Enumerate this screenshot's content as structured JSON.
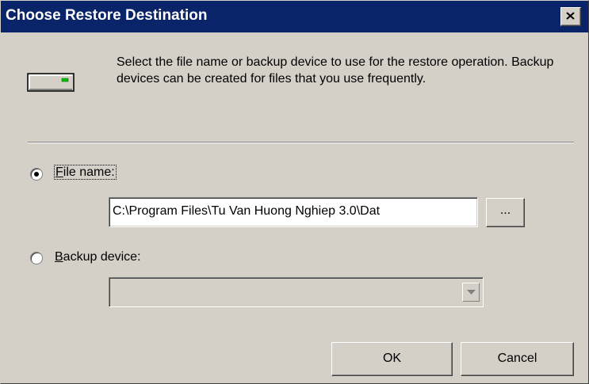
{
  "window": {
    "title": "Choose Restore Destination",
    "close_glyph": "×",
    "titlebar_color": "#0a246a",
    "face_color": "#d4d0c8"
  },
  "intro": {
    "icon": "backup-device-icon",
    "text": "Select the file name or backup device to use for the restore operation.  Backup devices can be created for files that you use frequently."
  },
  "file_name": {
    "mnemonic": "F",
    "label_rest": "ile name:",
    "selected": true,
    "value": "C:\\Program Files\\Tu Van Huong Nghiep 3.0\\Dat",
    "browse_label": "..."
  },
  "backup_device": {
    "mnemonic": "B",
    "label_rest": "ackup device:",
    "selected": false,
    "value": ""
  },
  "buttons": {
    "ok": "OK",
    "cancel": "Cancel"
  }
}
